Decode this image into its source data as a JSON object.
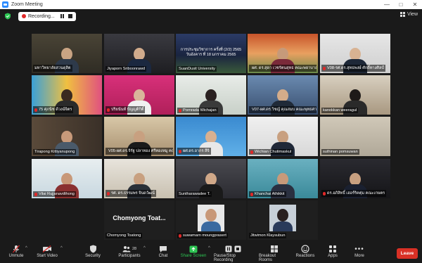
{
  "window": {
    "title": "Zoom Meeting"
  },
  "topbar": {
    "recording_label": "Recording...",
    "view_label": "View"
  },
  "participants_tiles": [
    {
      "name": "มหาวิทยาลัยสวนดุสิต",
      "muted": false
    },
    {
      "name": "Jiyaporn Sriboonrawd",
      "muted": false
    },
    {
      "name": "SuanDusit University",
      "muted": false,
      "banner_line1": "การประชุมวิชาการ ครั้งที่ (2/2) 2565",
      "banner_line2": "วันอังคาร ที่ 18 มกราคม 2565"
    },
    {
      "name": "ผศ. ดร.สุดา เวชรัตนสุทธ คณะพยาบาลศาสตร์",
      "muted": true
    },
    {
      "name": "V08-รศ.ดร.สุทธพงษ์ ศักดิ์ทางศิลป์",
      "muted": true
    },
    {
      "name": "75 ศุภนิช ด้วงฉ์จิตร",
      "muted": true
    },
    {
      "name": "ปริยนันท์ บัญญติกิติ์",
      "muted": true
    },
    {
      "name": "Pornrada Wichajan",
      "muted": true
    },
    {
      "name": "V07-ผศ.ดร.วิชญ์ คุณสมบ คณะพุทธศาสตร์",
      "muted": true
    },
    {
      "name": "kanokkan weeragul",
      "muted": false
    },
    {
      "name": "Tirapong Kittiyanupong",
      "muted": false
    },
    {
      "name": "V05-ผศ.ดร.จิรัฐ ปลาทอง ศรีทองหมู คณะ",
      "muted": true
    },
    {
      "name": "ผศ.ดร.อากร สีจิ",
      "muted": true
    },
    {
      "name": "Wichian Chutimaskul",
      "muted": true
    },
    {
      "name": "suthinan pomsuwan",
      "muted": false
    },
    {
      "name": "Vilai Rujjanavdthong",
      "muted": true
    },
    {
      "name": "รศ. ดร.ธรรมพร จินดวัฒน์",
      "muted": true
    },
    {
      "name": "Suntharawadee T.",
      "muted": false
    },
    {
      "name": "Khanchai Athikkit",
      "muted": true
    },
    {
      "name": "ดร.อภิสิทธิ์ เฮอร์ริคตุ่ม คณะเกษตร",
      "muted": true
    },
    {
      "name": "Chomyong Toatong",
      "muted": false,
      "big_label": "Chomyong Toat..."
    },
    {
      "name": "suwamarn moungprasert",
      "muted": true
    },
    {
      "name": "Jitwimon Klaysubun",
      "muted": false
    }
  ],
  "toolbar": {
    "unmute": "Unmute",
    "start_video": "Start Video",
    "security": "Security",
    "participants": "Participants",
    "participants_count": "28",
    "chat": "Chat",
    "share_screen": "Share Screen",
    "pause_stop_recording": "Pause/Stop Recording",
    "breakout_rooms": "Breakout Rooms",
    "reactions": "Reactions",
    "apps": "Apps",
    "more": "More",
    "leave": "Leave"
  },
  "colors": {
    "active_speaker": "#c8f000",
    "leave": "#d93025",
    "share": "#2dc653",
    "recording": "#e02828"
  }
}
